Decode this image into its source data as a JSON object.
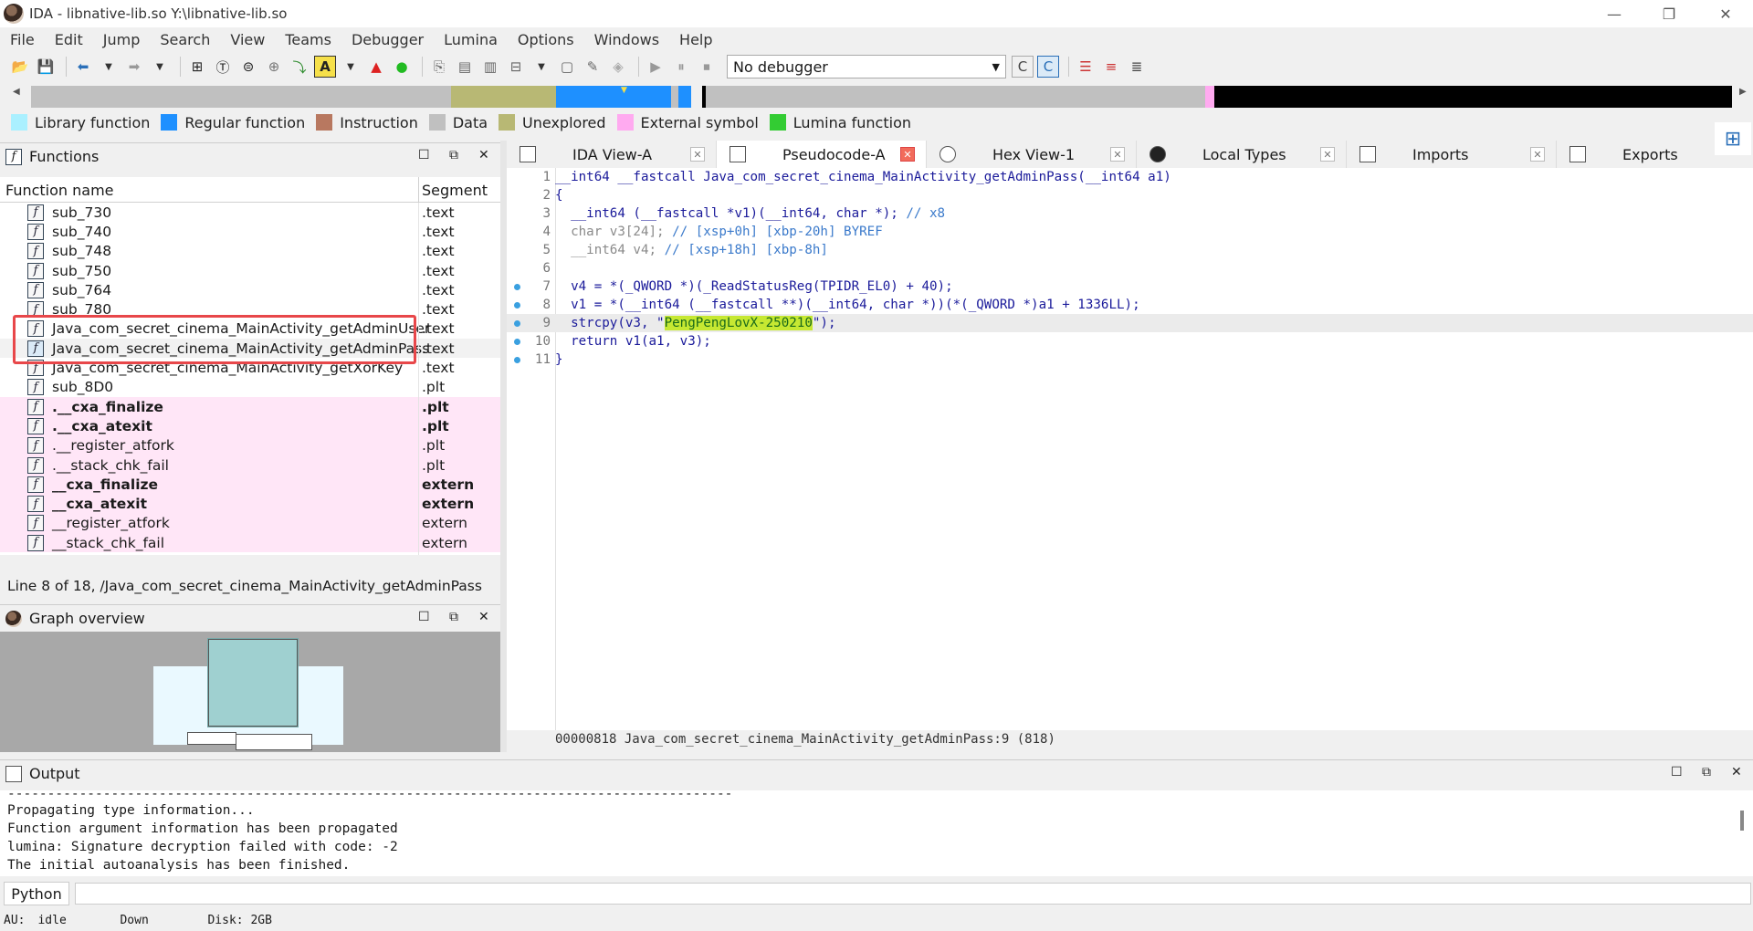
{
  "window": {
    "title": "IDA - libnative-lib.so Y:\\libnative-lib.so"
  },
  "menu": [
    "File",
    "Edit",
    "Jump",
    "Search",
    "View",
    "Teams",
    "Debugger",
    "Lumina",
    "Options",
    "Windows",
    "Help"
  ],
  "toolbar": {
    "debugger_select": "No debugger"
  },
  "legend": [
    {
      "label": "Library function",
      "color": "#aaf0ff"
    },
    {
      "label": "Regular function",
      "color": "#1e90ff"
    },
    {
      "label": "Instruction",
      "color": "#b87860"
    },
    {
      "label": "Data",
      "color": "#c0c0c0"
    },
    {
      "label": "Unexplored",
      "color": "#b8b874"
    },
    {
      "label": "External symbol",
      "color": "#ffaaf0"
    },
    {
      "label": "Lumina function",
      "color": "#33cc33"
    }
  ],
  "functions_panel": {
    "title": "Functions",
    "col_name": "Function name",
    "col_segment": "Segment",
    "rows": [
      {
        "name": "sub_730",
        "seg": ".text"
      },
      {
        "name": "sub_740",
        "seg": ".text"
      },
      {
        "name": "sub_748",
        "seg": ".text"
      },
      {
        "name": "sub_750",
        "seg": ".text"
      },
      {
        "name": "sub_764",
        "seg": ".text"
      },
      {
        "name": "sub_780",
        "seg": ".text"
      },
      {
        "name": "Java_com_secret_cinema_MainActivity_getAdminUser",
        "seg": ".text"
      },
      {
        "name": "Java_com_secret_cinema_MainActivity_getAdminPass",
        "seg": ".text"
      },
      {
        "name": "Java_com_secret_cinema_MainActivity_getXorKey",
        "seg": ".text"
      },
      {
        "name": "sub_8D0",
        "seg": ".plt"
      },
      {
        "name": ".__cxa_finalize",
        "seg": ".plt"
      },
      {
        "name": ".__cxa_atexit",
        "seg": ".plt"
      },
      {
        "name": ".__register_atfork",
        "seg": ".plt"
      },
      {
        "name": ".__stack_chk_fail",
        "seg": ".plt"
      },
      {
        "name": "__cxa_finalize",
        "seg": "extern"
      },
      {
        "name": "__cxa_atexit",
        "seg": "extern"
      },
      {
        "name": "__register_atfork",
        "seg": "extern"
      },
      {
        "name": "__stack_chk_fail",
        "seg": "extern"
      }
    ],
    "status": "Line 8 of 18, /Java_com_secret_cinema_MainActivity_getAdminPass"
  },
  "graph_overview": {
    "title": "Graph overview"
  },
  "tabs": [
    {
      "label": "IDA View-A"
    },
    {
      "label": "Pseudocode-A"
    },
    {
      "label": "Hex View-1"
    },
    {
      "label": "Local Types"
    },
    {
      "label": "Imports"
    },
    {
      "label": "Exports"
    }
  ],
  "code": {
    "line_numbers": [
      "1",
      "2",
      "3",
      "4",
      "5",
      "6",
      "7",
      "8",
      "9",
      "10",
      "11"
    ],
    "l1_sig": "__int64 __fastcall Java_com_secret_cinema_MainActivity_getAdminPass(__int64 a1)",
    "l2": "{",
    "l3_code": "  __int64 (__fastcall *v1)(__int64, char *); ",
    "l3_cmt": "// x8",
    "l4_code": "  char v3[24]; ",
    "l4_cmt": "// [xsp+0h] [xbp-20h] BYREF",
    "l5_code": "  __int64 v4; ",
    "l5_cmt": "// [xsp+18h] [xbp-8h]",
    "l7": "  v4 = *(_QWORD *)(_ReadStatusReg(TPIDR_EL0) + 40);",
    "l8": "  v1 = *(__int64 (__fastcall **)(__int64, char *))(*(_QWORD *)a1 + 1336LL);",
    "l9_pre": "  strcpy(v3, \"",
    "l9_str": "PengPengLovX-250210",
    "l9_post": "\");",
    "l10": "  return v1(a1, v3);",
    "l11": "}",
    "status": "00000818 Java_com_secret_cinema_MainActivity_getAdminPass:9 (818)"
  },
  "output": {
    "title": "Output",
    "lines": [
      "-------------------------------------------------------------------------------------------",
      "Propagating type information...",
      "Function argument information has been propagated",
      "lumina: Signature decryption failed with code: -2",
      "The initial autoanalysis has been finished."
    ]
  },
  "python_button": "Python",
  "statusbar": {
    "au_label": "AU:",
    "au_value": "idle",
    "down": "Down",
    "disk": "Disk: 2GB"
  }
}
